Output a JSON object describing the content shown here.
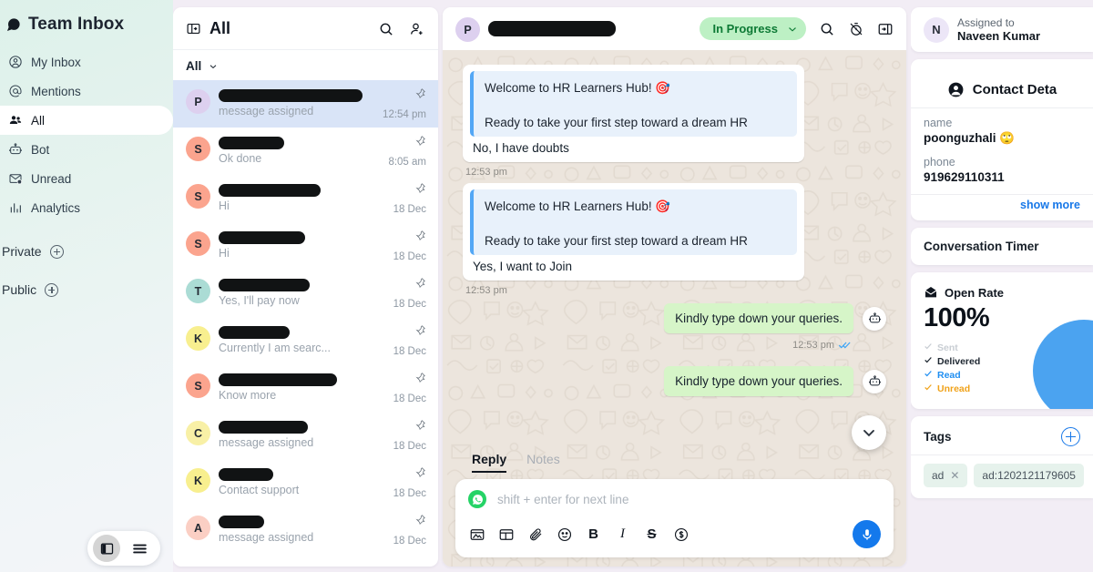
{
  "sidebar": {
    "title": "Team Inbox",
    "items": [
      {
        "label": "My Inbox",
        "icon": "user-circle-icon"
      },
      {
        "label": "Mentions",
        "icon": "at-icon"
      },
      {
        "label": "All",
        "icon": "people-icon"
      },
      {
        "label": "Bot",
        "icon": "robot-icon"
      },
      {
        "label": "Unread",
        "icon": "envelope-alert-icon"
      },
      {
        "label": "Analytics",
        "icon": "bar-chart-icon"
      }
    ],
    "active_item": "All",
    "groups": [
      {
        "label": "Private"
      },
      {
        "label": "Public"
      }
    ]
  },
  "conversation_list": {
    "header_title": "All",
    "filter_label": "All",
    "rows": [
      {
        "initial": "P",
        "avatar_color": "#ddd0ef",
        "preview": "message assigned",
        "time": "12:54 pm",
        "redact_width": 158,
        "selected": true
      },
      {
        "initial": "S",
        "avatar_color": "#fba48e",
        "preview": "Ok done",
        "time": "8:05 am",
        "redact_width": 72,
        "selected": false
      },
      {
        "initial": "S",
        "avatar_color": "#fba48e",
        "preview": "Hi",
        "time": "18 Dec",
        "redact_width": 112,
        "selected": false
      },
      {
        "initial": "S",
        "avatar_color": "#fba48e",
        "preview": "Hi",
        "time": "18 Dec",
        "redact_width": 95,
        "selected": false
      },
      {
        "initial": "T",
        "avatar_color": "#abdcd5",
        "preview": "Yes, I'll pay now",
        "time": "18 Dec",
        "redact_width": 100,
        "selected": false
      },
      {
        "initial": "K",
        "avatar_color": "#f8ef8f",
        "preview": "Currently I am searc...",
        "time": "18 Dec",
        "redact_width": 78,
        "selected": false
      },
      {
        "initial": "S",
        "avatar_color": "#fba48e",
        "preview": "Know more",
        "time": "18 Dec",
        "redact_width": 130,
        "selected": false
      },
      {
        "initial": "C",
        "avatar_color": "#f8f0a6",
        "preview": "message assigned",
        "time": "18 Dec",
        "redact_width": 98,
        "selected": false
      },
      {
        "initial": "K",
        "avatar_color": "#f8ef8f",
        "preview": "Contact support",
        "time": "18 Dec",
        "redact_width": 60,
        "selected": false
      },
      {
        "initial": "A",
        "avatar_color": "#fbcfc4",
        "preview": "message assigned",
        "time": "18 Dec",
        "redact_width": 50,
        "selected": false
      }
    ]
  },
  "chat": {
    "contact_initial": "P",
    "status_badge": "In Progress",
    "messages": [
      {
        "direction": "in",
        "quote_line1": "Welcome to HR Learners Hub! 🎯",
        "quote_line2": "Ready to take your first step toward a dream HR",
        "body": "No, I have doubts",
        "time": "12:53 pm"
      },
      {
        "direction": "in",
        "quote_line1": "Welcome to HR Learners Hub! 🎯",
        "quote_line2": "Ready to take your first step toward a dream HR",
        "body": "Yes, I want to Join",
        "time": "12:53 pm"
      },
      {
        "direction": "out",
        "body": "Kindly type down your queries.",
        "time": "12:53 pm",
        "receipt": "read"
      },
      {
        "direction": "out",
        "body": "Kindly type down your queries.",
        "time": "",
        "receipt": "read"
      }
    ]
  },
  "composer": {
    "tabs": [
      {
        "label": "Reply",
        "active": true
      },
      {
        "label": "Notes",
        "active": false
      }
    ],
    "placeholder": "shift + enter for next line",
    "channel_icon": "whatsapp-icon",
    "tools": [
      {
        "icon": "image-icon"
      },
      {
        "icon": "template-icon"
      },
      {
        "icon": "attachment-icon"
      },
      {
        "icon": "emoji-icon"
      },
      {
        "icon": "bold-icon",
        "glyph": "B"
      },
      {
        "icon": "italic-icon",
        "glyph": "I"
      },
      {
        "icon": "strikethrough-icon",
        "glyph": "S"
      },
      {
        "icon": "price-icon"
      }
    ],
    "send_icon": "microphone-icon"
  },
  "right_panel": {
    "assigned_label": "Assigned to",
    "assigned_name": "Naveen Kumar",
    "assigned_initial": "N",
    "contact_details_title": "Contact Deta",
    "fields": [
      {
        "label": "name",
        "value": "poonguzhali 🙄"
      },
      {
        "label": "phone",
        "value": "919629110311"
      }
    ],
    "show_more": "show more",
    "conversation_timer_title": "Conversation Timer",
    "open_rate_title": "Open Rate",
    "open_rate_value": "100%",
    "legend": [
      {
        "label": "Sent",
        "color": "#c8cdd3"
      },
      {
        "label": "Delivered",
        "color": "#1d2630"
      },
      {
        "label": "Read",
        "color": "#1f8ef1"
      },
      {
        "label": "Unread",
        "color": "#f0a21a"
      }
    ],
    "tags_title": "Tags",
    "tags": [
      {
        "label": "ad",
        "removable": true
      },
      {
        "label": "ad:1202121179605",
        "removable": false
      }
    ]
  },
  "chart_data": {
    "type": "pie",
    "title": "Open Rate",
    "categories": [
      "Read"
    ],
    "values": [
      100
    ],
    "colors": [
      "#4ba3f0"
    ],
    "center_label": "100%",
    "legend": [
      "Sent",
      "Delivered",
      "Read",
      "Unread"
    ],
    "legend_position": "left"
  }
}
